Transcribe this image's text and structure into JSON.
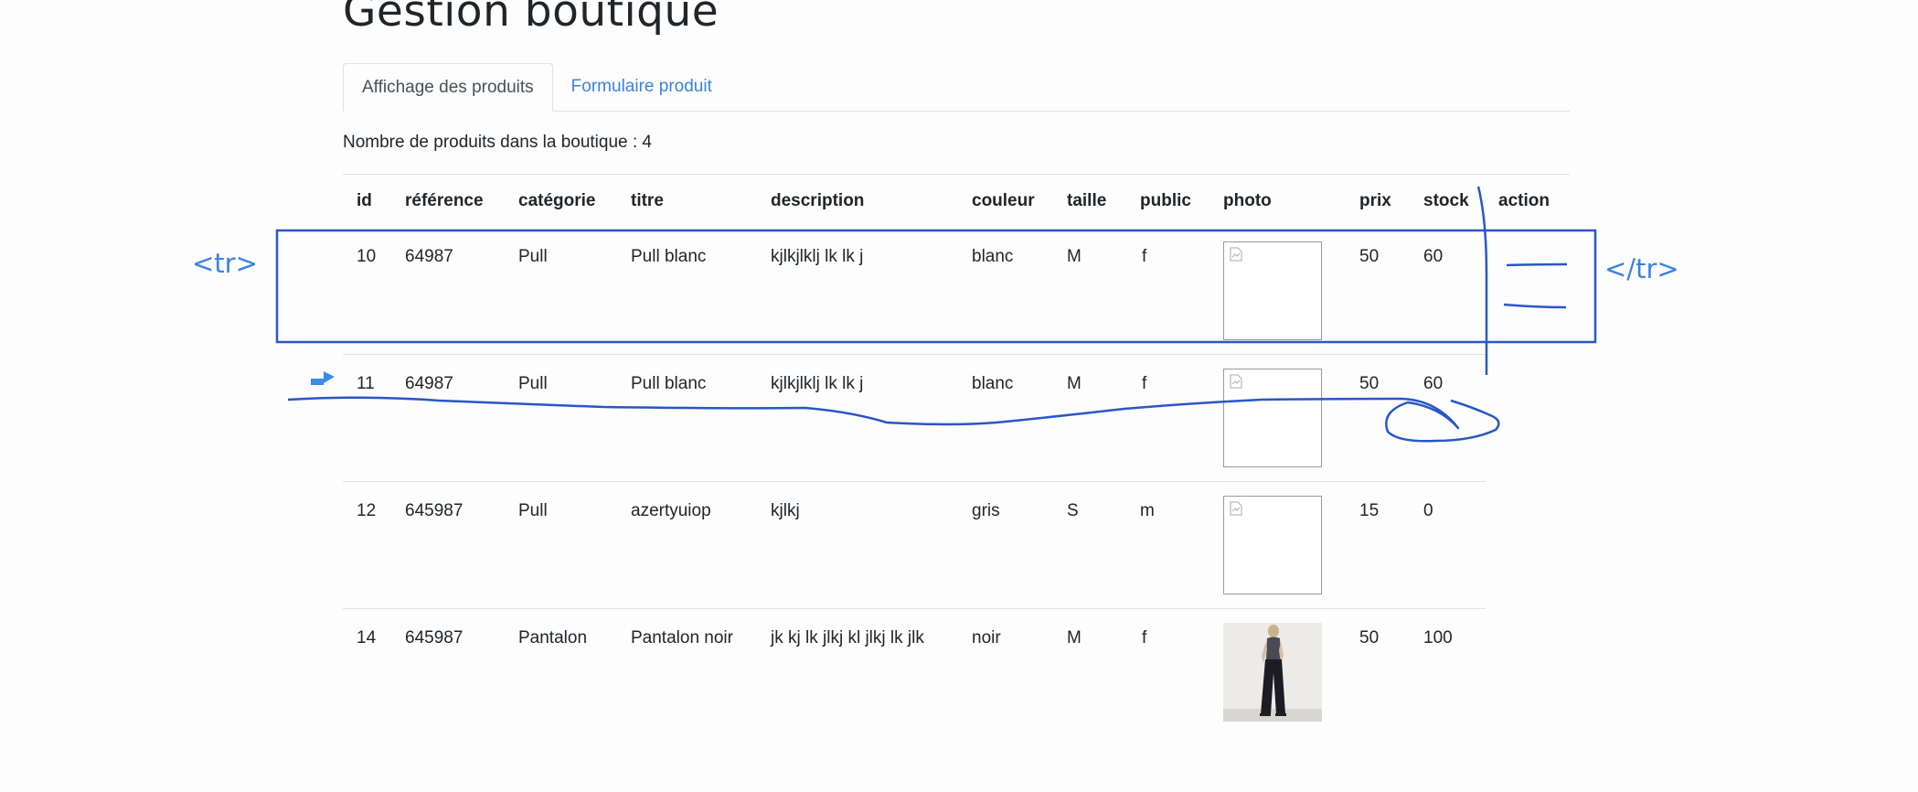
{
  "page": {
    "title": "Gestion boutique"
  },
  "tabs": [
    {
      "label": "Affichage des produits",
      "active": true
    },
    {
      "label": "Formulaire produit",
      "active": false
    }
  ],
  "summary": {
    "text": "Nombre de produits dans la boutique : 4"
  },
  "table": {
    "headers": [
      "id",
      "référence",
      "catégorie",
      "titre",
      "description",
      "couleur",
      "taille",
      "public",
      "photo",
      "prix",
      "stock",
      "action"
    ],
    "rows": [
      {
        "id": "10",
        "reference": "64987",
        "categorie": "Pull",
        "titre": "Pull blanc",
        "description": "kjlkjlklj lk lk j",
        "couleur": "blanc",
        "taille": "M",
        "public": "f",
        "photo": "broken-image-icon",
        "prix": "50",
        "stock": "60"
      },
      {
        "id": "11",
        "reference": "64987",
        "categorie": "Pull",
        "titre": "Pull blanc",
        "description": "kjlkjlklj lk lk j",
        "couleur": "blanc",
        "taille": "M",
        "public": "f",
        "photo": "broken-image-icon",
        "prix": "50",
        "stock": "60"
      },
      {
        "id": "12",
        "reference": "645987",
        "categorie": "Pull",
        "titre": "azertyuiop",
        "description": "kjlkj",
        "couleur": "gris",
        "taille": "S",
        "public": "m",
        "photo": "broken-image-icon",
        "prix": "15",
        "stock": "0"
      },
      {
        "id": "14",
        "reference": "645987",
        "categorie": "Pantalon",
        "titre": "Pantalon noir",
        "description": "jk kj lk jlkj kl jlkj lk jlk",
        "couleur": "noir",
        "taille": "M",
        "public": "f",
        "photo": "product-photo-woman-black-pants",
        "prix": "50",
        "stock": "100"
      }
    ]
  },
  "annotations": {
    "tr_open": "<tr>",
    "tr_close": "</tr>",
    "color": "#3b82e0",
    "ink_color": "#2a56c6"
  },
  "colors": {
    "link": "#3b82e0",
    "border": "#dee2e6",
    "text": "#212529"
  }
}
